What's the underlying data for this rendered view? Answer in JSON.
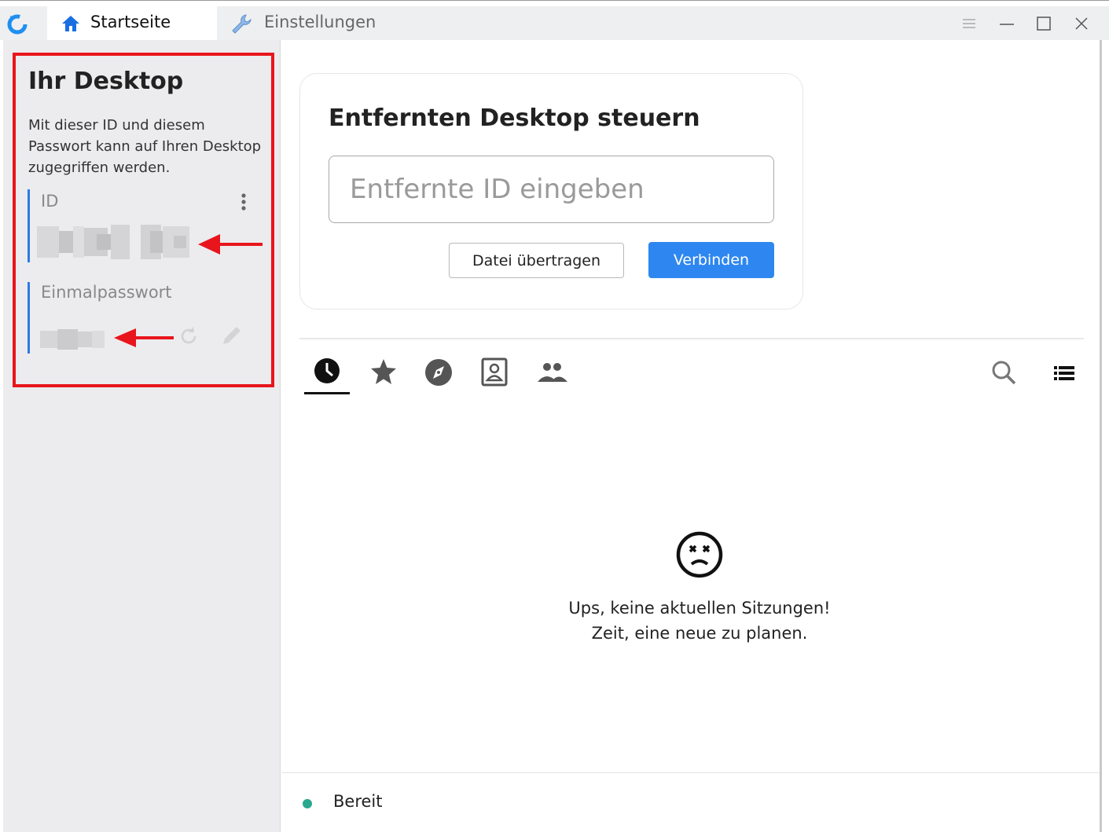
{
  "tabs": [
    {
      "label": "Startseite",
      "icon": "home-icon"
    },
    {
      "label": "Einstellungen",
      "icon": "wrench-icon"
    }
  ],
  "window_controls": [
    "menu-icon",
    "minimize-icon",
    "maximize-icon",
    "close-icon"
  ],
  "sidebar": {
    "title": "Ihr Desktop",
    "description": "Mit dieser ID und diesem Passwort kann auf Ihren Desktop zugegriffen werden.",
    "id_label": "ID",
    "password_label": "Einmalpasswort"
  },
  "connect": {
    "title": "Entfernten Desktop steuern",
    "input_placeholder": "Entfernte ID eingeben",
    "input_value": "",
    "transfer_button": "Datei übertragen",
    "connect_button": "Verbinden"
  },
  "session_tabs": [
    {
      "icon": "clock-icon",
      "active": true
    },
    {
      "icon": "star-icon",
      "active": false
    },
    {
      "icon": "compass-icon",
      "active": false
    },
    {
      "icon": "address-book-icon",
      "active": false
    },
    {
      "icon": "group-icon",
      "active": false
    }
  ],
  "empty_state": {
    "line1": "Ups, keine aktuellen Sitzungen!",
    "line2": "Zeit, eine neue zu planen."
  },
  "status": {
    "text": "Bereit",
    "color": "#2aa88f"
  },
  "colors": {
    "accent": "#2e87f0",
    "annotation_red": "#e8151d",
    "id_bar": "#2c7be5"
  }
}
